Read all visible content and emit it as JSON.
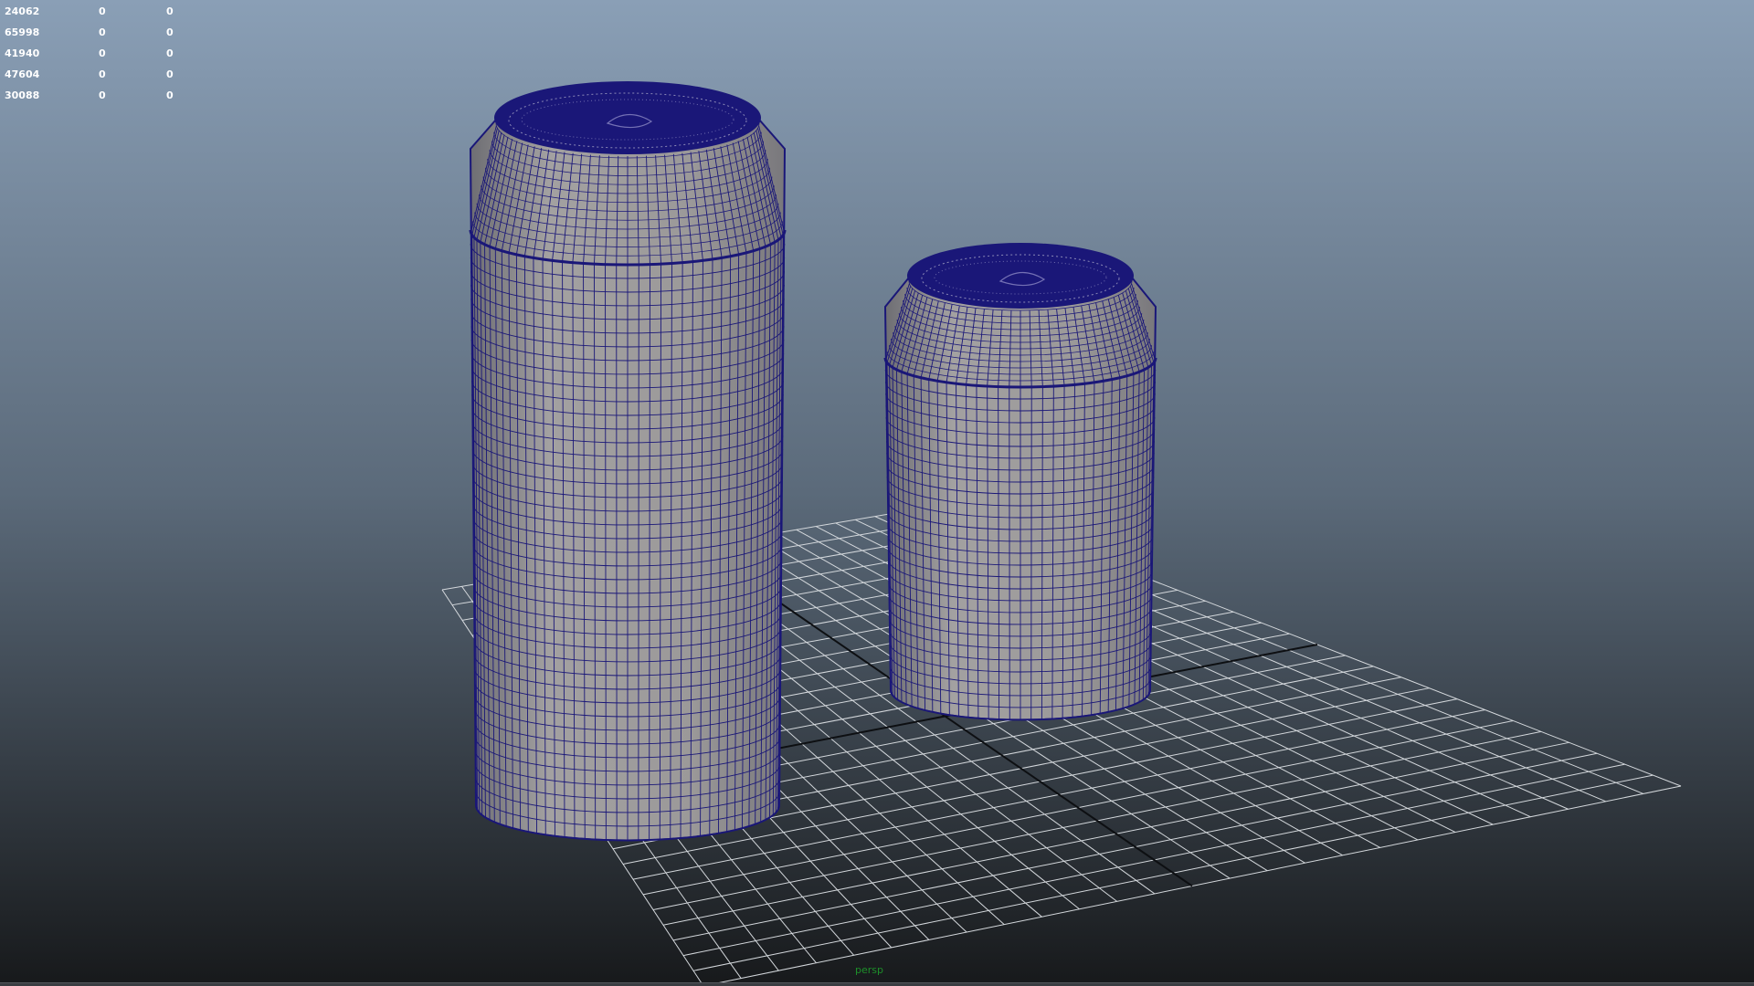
{
  "viewport": {
    "camera_label": "persp",
    "background_top": "#8a9fb6",
    "background_bottom": "#17191b"
  },
  "heads_up_display": {
    "rows": [
      [
        "24062",
        "0",
        "0"
      ],
      [
        "65998",
        "0",
        "0"
      ],
      [
        "41940",
        "0",
        "0"
      ],
      [
        "47604",
        "0",
        "0"
      ],
      [
        "30088",
        "0",
        "0"
      ]
    ]
  },
  "scene": {
    "grid_color": "#d4d8dc",
    "axis_color": "#0d0f12",
    "mesh_fill": "#9a9898",
    "wireframe_color": "#1a1778",
    "objects": [
      {
        "name": "tall-can",
        "type": "mesh",
        "shape": "can"
      },
      {
        "name": "short-can",
        "type": "mesh",
        "shape": "can"
      }
    ]
  }
}
